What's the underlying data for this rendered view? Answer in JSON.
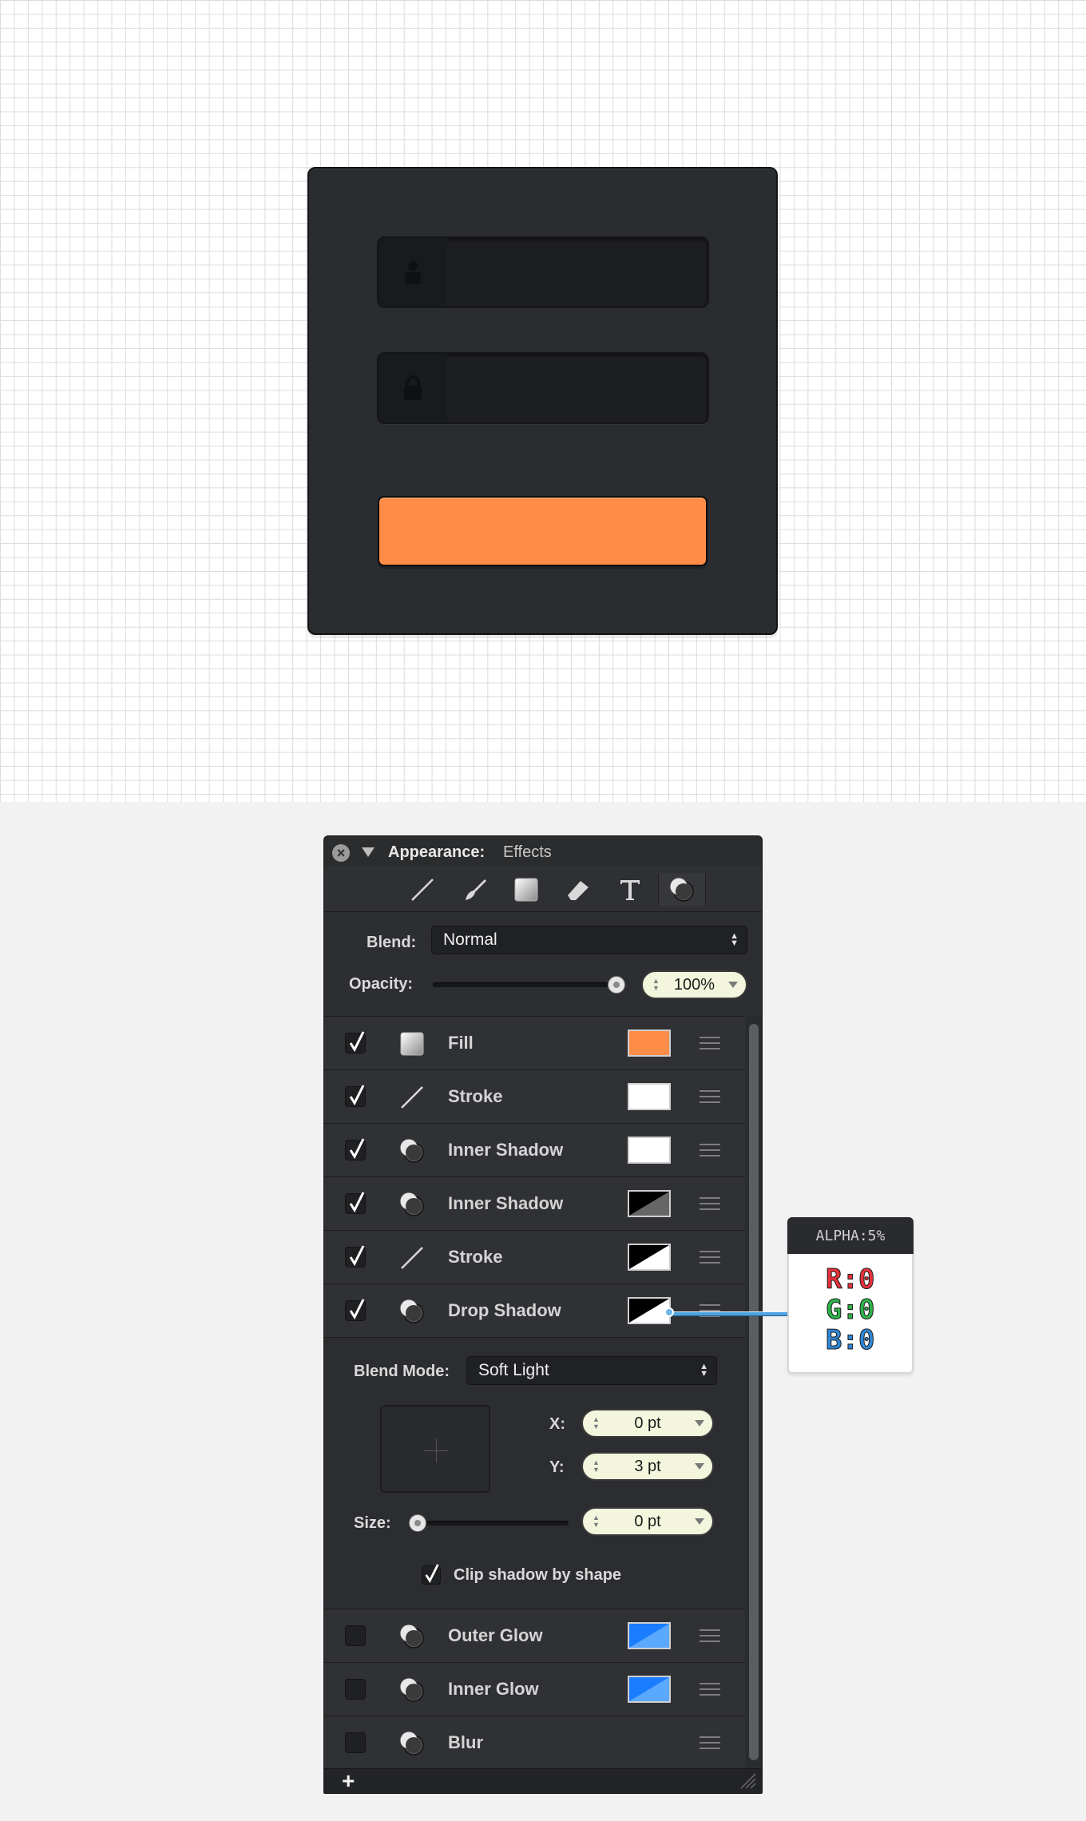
{
  "panel": {
    "title": "Appearance:",
    "subtitle": "Effects",
    "blend_label": "Blend:",
    "blend_value": "Normal",
    "opacity_label": "Opacity:",
    "opacity_value": "100%",
    "opacity_level": 1.0,
    "effects": [
      {
        "name": "Fill",
        "checked": true,
        "icon": "fill-icon",
        "swatch": "#ff8d47"
      },
      {
        "name": "Stroke",
        "checked": true,
        "icon": "stroke-icon",
        "swatch": "#ffffff"
      },
      {
        "name": "Inner Shadow",
        "checked": true,
        "icon": "shadow-icon",
        "swatch": "#ffffff"
      },
      {
        "name": "Inner Shadow",
        "checked": true,
        "icon": "shadow-icon",
        "swatch": "black-diagonal"
      },
      {
        "name": "Stroke",
        "checked": true,
        "icon": "stroke-icon",
        "swatch": "black-white-diagonal"
      },
      {
        "name": "Drop Shadow",
        "checked": true,
        "icon": "shadow-icon",
        "swatch": "black-white-diagonal"
      }
    ],
    "drop_shadow": {
      "blend_mode_label": "Blend Mode:",
      "blend_mode_value": "Soft Light",
      "x_label": "X:",
      "x_value": "0 pt",
      "y_label": "Y:",
      "y_value": "3 pt",
      "size_label": "Size:",
      "size_value": "0 pt",
      "size_level": 0.0,
      "clip_label": "Clip shadow by shape",
      "clip_checked": true
    },
    "effects_more": [
      {
        "name": "Outer Glow",
        "checked": false,
        "icon": "shadow-icon",
        "swatch": "#2a8bff"
      },
      {
        "name": "Inner Glow",
        "checked": false,
        "icon": "shadow-icon",
        "swatch": "#2a8bff"
      },
      {
        "name": "Blur",
        "checked": false,
        "icon": "shadow-icon",
        "swatch": ""
      }
    ],
    "footer_add": "+"
  },
  "callout": {
    "header": "ALPHA:5%",
    "r": "R:0",
    "g": "G:0",
    "b": "B:0",
    "r_color": "#e8323c",
    "g_color": "#2db34a",
    "b_color": "#2f86d6"
  },
  "colors": {
    "accent_orange": "#ff8d47",
    "card_bg": "#2b2c2f",
    "panel_bg": "#2d2e31"
  }
}
